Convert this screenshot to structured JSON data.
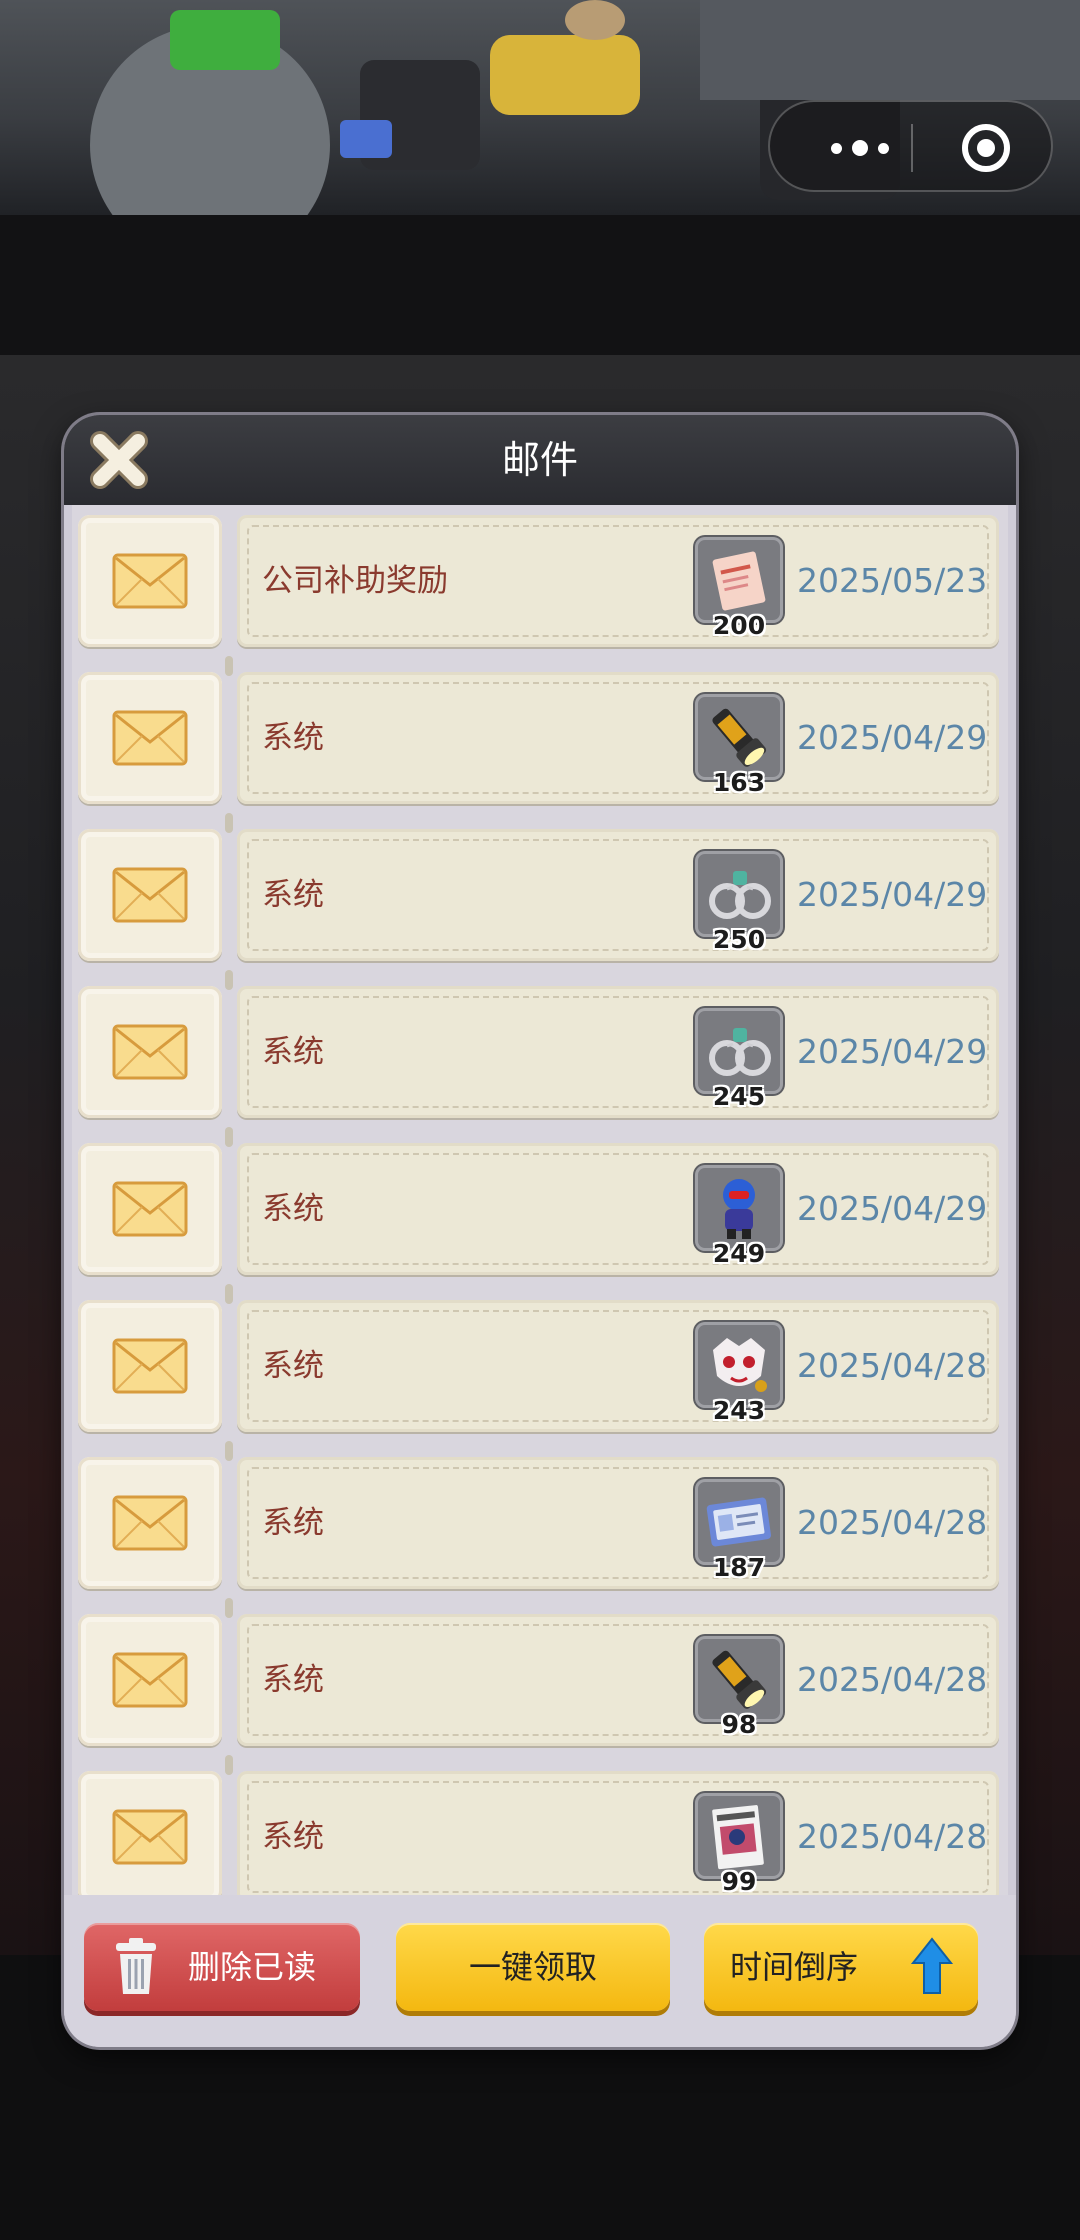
{
  "dialog": {
    "title": "邮件"
  },
  "mails": [
    {
      "sender": "公司补助奖励",
      "item_icon": "document-icon",
      "count": "200",
      "date": "2025/05/23"
    },
    {
      "sender": "系统",
      "item_icon": "flashlight-icon",
      "count": "163",
      "date": "2025/04/29"
    },
    {
      "sender": "系统",
      "item_icon": "handcuffs-icon",
      "count": "250",
      "date": "2025/04/29"
    },
    {
      "sender": "系统",
      "item_icon": "handcuffs-icon",
      "count": "245",
      "date": "2025/04/29"
    },
    {
      "sender": "系统",
      "item_icon": "hero-figure-icon",
      "count": "249",
      "date": "2025/04/29"
    },
    {
      "sender": "系统",
      "item_icon": "mask-icon",
      "count": "243",
      "date": "2025/04/28"
    },
    {
      "sender": "系统",
      "item_icon": "id-card-icon",
      "count": "187",
      "date": "2025/04/28"
    },
    {
      "sender": "系统",
      "item_icon": "flashlight-icon",
      "count": "98",
      "date": "2025/04/28"
    },
    {
      "sender": "系统",
      "item_icon": "newspaper-icon",
      "count": "99",
      "date": "2025/04/28"
    }
  ],
  "footer": {
    "delete_read_label": "删除已读",
    "claim_all_label": "一键领取",
    "sort_label": "时间倒序"
  },
  "colors": {
    "sender_text": "#8a3a2e",
    "date_text": "#5b86a8",
    "delete_button": "#c23d3d",
    "primary_button": "#f4b810"
  }
}
